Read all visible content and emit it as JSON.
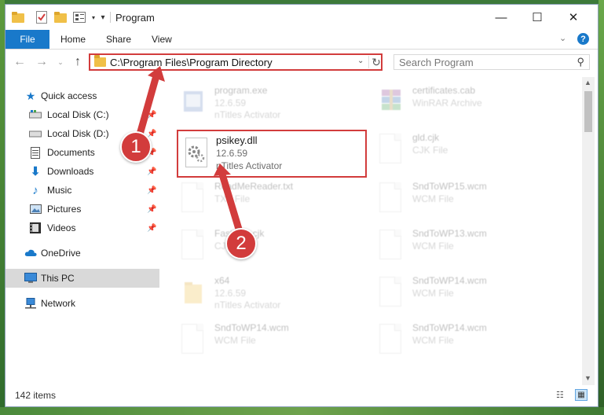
{
  "window": {
    "title": "Program",
    "controls": {
      "minimize": "—",
      "maximize": "☐",
      "close": "✕"
    }
  },
  "ribbon": {
    "tabs": [
      "File",
      "Home",
      "Share",
      "View"
    ],
    "help": "?"
  },
  "address_bar": {
    "path": "C:\\Program Files\\Program Directory",
    "search_placeholder": "Search Program"
  },
  "sidebar": {
    "items": [
      {
        "label": "Quick access",
        "icon": "star-icon",
        "pinned": false
      },
      {
        "label": "Local Disk (C:)",
        "icon": "drive-icon",
        "pinned": true
      },
      {
        "label": "Local Disk (D:)",
        "icon": "drive-icon",
        "pinned": true
      },
      {
        "label": "Documents",
        "icon": "documents-icon",
        "pinned": true
      },
      {
        "label": "Downloads",
        "icon": "downloads-icon",
        "pinned": true
      },
      {
        "label": "Music",
        "icon": "music-icon",
        "pinned": true
      },
      {
        "label": "Pictures",
        "icon": "pictures-icon",
        "pinned": true
      },
      {
        "label": "Videos",
        "icon": "videos-icon",
        "pinned": true
      },
      {
        "label": "OneDrive",
        "icon": "cloud-icon",
        "pinned": false
      },
      {
        "label": "This PC",
        "icon": "computer-icon",
        "pinned": false,
        "selected": true
      },
      {
        "label": "Network",
        "icon": "network-icon",
        "pinned": false
      }
    ]
  },
  "files": [
    {
      "name": "program.exe",
      "line2": "12.6.59",
      "line3": "nTitles Activator",
      "icon": "exe-icon"
    },
    {
      "name": "certificates.cab",
      "line2": "WinRAR Archive",
      "line3": "",
      "icon": "archive-icon"
    },
    {
      "name": "psikey.dll",
      "line2": "12.6.59",
      "line3": "nTitles Activator",
      "icon": "dll-gear-icon"
    },
    {
      "name": "gld.cjk",
      "line2": "CJK File",
      "line3": "",
      "icon": "file-icon"
    },
    {
      "name": "ReadMeReader.txt",
      "line2": "TXT File",
      "line3": "",
      "icon": "file-icon"
    },
    {
      "name": "SndToWP15.wcm",
      "line2": "WCM File",
      "line3": "",
      "icon": "file-icon"
    },
    {
      "name": "FastText.cjk",
      "line2": "CJK File",
      "line3": "",
      "icon": "file-icon"
    },
    {
      "name": "SndToWP13.wcm",
      "line2": "WCM File",
      "line3": "",
      "icon": "file-icon"
    },
    {
      "name": "x64",
      "line2": "12.6.59",
      "line3": "nTitles Activator",
      "icon": "folder-icon"
    },
    {
      "name": "SndToWP14.wcm",
      "line2": "WCM File",
      "line3": "",
      "icon": "file-icon"
    },
    {
      "name": "SndToWP14.wcm",
      "line2": "WCM File",
      "line3": "",
      "icon": "file-icon"
    },
    {
      "name": "SndToWP14.wcm",
      "line2": "WCM File",
      "line3": "",
      "icon": "file-icon"
    }
  ],
  "status": {
    "item_count": "142 items"
  },
  "annotations": {
    "step1": "1",
    "step2": "2"
  },
  "colors": {
    "accent": "#1979ca",
    "highlight": "#d23c3c",
    "selected_nav": "#d9d9d9"
  }
}
